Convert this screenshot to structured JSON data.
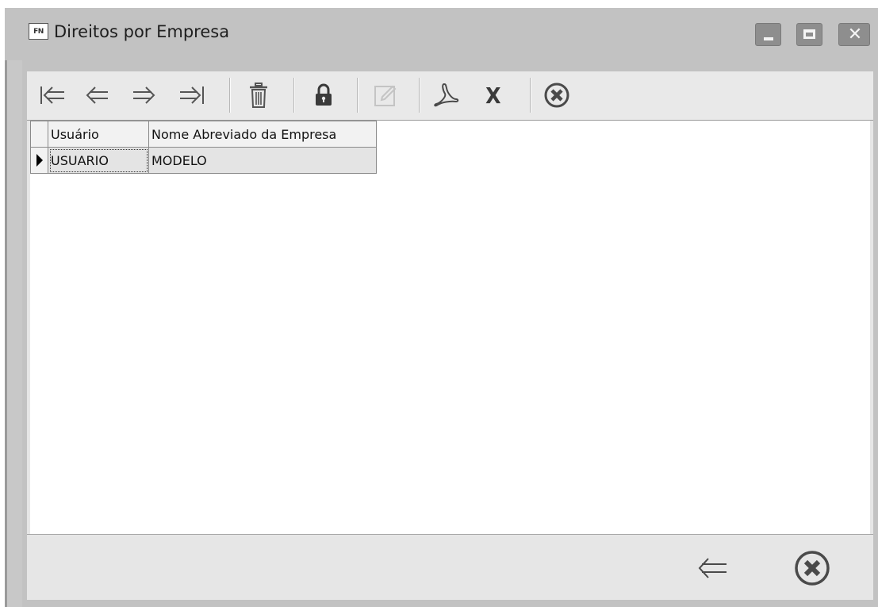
{
  "window": {
    "icon_text": "FN",
    "title": "Direitos por Empresa"
  },
  "toolbar": {
    "items": [
      {
        "name": "first-record-icon"
      },
      {
        "name": "prev-record-icon"
      },
      {
        "name": "next-record-icon"
      },
      {
        "name": "last-record-icon"
      },
      {
        "name": "trash-icon"
      },
      {
        "name": "lock-icon"
      },
      {
        "name": "edit-icon",
        "disabled": true
      },
      {
        "name": "pdf-icon"
      },
      {
        "name": "excel-icon",
        "glyph": "X"
      },
      {
        "name": "close-circle-icon"
      }
    ]
  },
  "grid": {
    "columns": [
      "Usuário",
      "Nome Abreviado da Empresa"
    ],
    "rows": [
      [
        "USUARIO",
        "MODELO"
      ]
    ]
  },
  "footer": {
    "buttons": [
      {
        "name": "back-arrow-icon"
      },
      {
        "name": "close-circle-icon"
      }
    ]
  },
  "colors": {
    "window_frame": "#c2c2c2",
    "client_bg": "#e6e6e6",
    "grid_bg": "#ffffff",
    "icon": "#4a4a4a",
    "caption_button": "#8e8e8e"
  }
}
